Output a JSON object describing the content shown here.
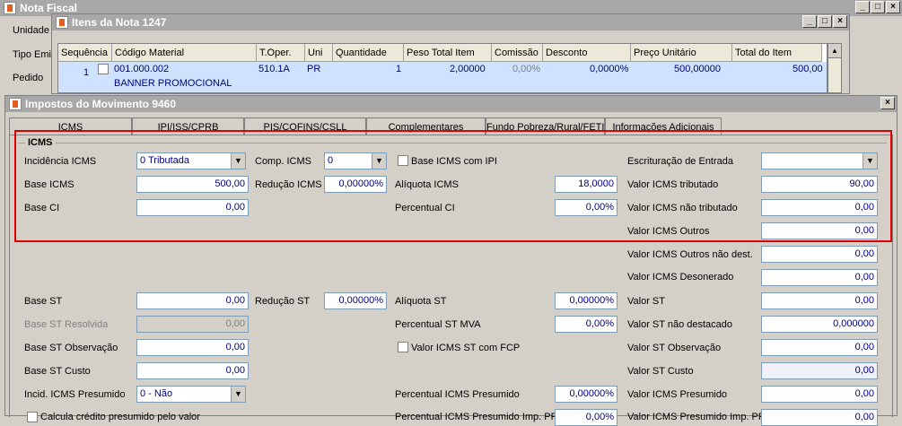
{
  "nota": {
    "title": "Nota Fiscal",
    "labels": [
      "Unidade",
      "Tipo Emis",
      "Pedido"
    ]
  },
  "itens": {
    "title": "Itens da Nota 1247",
    "columns": [
      "Sequência",
      "Código Material",
      "T.Oper.",
      "Uni",
      "Quantidade",
      "Peso Total Item",
      "Comissão",
      "Desconto",
      "Preço Unitário",
      "Total do Item"
    ],
    "row": {
      "seq": "1",
      "codigo": "001.000.002",
      "descricao": "BANNER PROMOCIONAL",
      "toper": "510.1A",
      "uni": "PR",
      "quantidade": "1",
      "peso": "2,00000",
      "comissao": "0,00%",
      "desconto": "0,0000%",
      "preco": "500,00000",
      "total": "500,00"
    }
  },
  "impostos": {
    "title": "Impostos do Movimento 9460",
    "tabs": [
      "ICMS",
      "IPI/ISS/CPRB",
      "PIS/COFINS/CSLL",
      "Complementares",
      "Fundo Pobreza/Rural/FETI",
      "Informações Adicionais"
    ],
    "group_title": "ICMS",
    "fields": {
      "incidencia_label": "Incidência ICMS",
      "incidencia_value": "0 Tributada",
      "comp_label": "Comp. ICMS",
      "comp_value": "0",
      "base_com_ipi_label": "Base ICMS com IPI",
      "escrituracao_label": "Escrituração de Entrada",
      "escrituracao_value": "",
      "base_icms_label": "Base ICMS",
      "base_icms_value": "500,00",
      "reducao_icms_label": "Redução ICMS",
      "reducao_icms_value": "0,00000%",
      "aliquota_icms_label": "Alíquota ICMS",
      "aliquota_icms_value": "18,0000",
      "valor_icms_trib_label": "Valor ICMS tributado",
      "valor_icms_trib_value": "90,00",
      "base_ci_label": "Base CI",
      "base_ci_value": "0,00",
      "percentual_ci_label": "Percentual CI",
      "percentual_ci_value": "0,00%",
      "valor_icms_ntrib_label": "Valor ICMS não tributado",
      "valor_icms_ntrib_value": "0,00",
      "valor_icms_outros_label": "Valor ICMS Outros",
      "valor_icms_outros_value": "0,00",
      "valor_icms_outros_nd_label": "Valor ICMS Outros não dest.",
      "valor_icms_outros_nd_value": "0,00",
      "valor_icms_deson_label": "Valor ICMS Desonerado",
      "valor_icms_deson_value": "0,00",
      "base_st_label": "Base ST",
      "base_st_value": "0,00",
      "reducao_st_label": "Redução ST",
      "reducao_st_value": "0,00000%",
      "aliquota_st_label": "Alíquota ST",
      "aliquota_st_value": "0,00000%",
      "valor_st_label": "Valor ST",
      "valor_st_value": "0,00",
      "base_st_resolvida_label": "Base ST Resolvida",
      "base_st_resolvida_value": "0,00",
      "percentual_st_mva_label": "Percentual ST MVA",
      "percentual_st_mva_value": "0,00%",
      "valor_st_nd_label": "Valor ST não destacado",
      "valor_st_nd_value": "0,000000",
      "base_st_obs_label": "Base ST Observação",
      "base_st_obs_value": "0,00",
      "valor_icms_st_fcp_label": "Valor ICMS ST com FCP",
      "valor_st_obs_label": "Valor ST Observação",
      "valor_st_obs_value": "0,00",
      "base_st_custo_label": "Base ST Custo",
      "base_st_custo_value": "0,00",
      "valor_st_custo_label": "Valor ST Custo",
      "valor_st_custo_value": "0,00",
      "incid_presumido_label": "Incid. ICMS Presumido",
      "incid_presumido_value": "0 - Não",
      "percentual_presumido_label": "Percentual ICMS Presumido",
      "percentual_presumido_value": "0,00000%",
      "valor_presumido_label": "Valor ICMS Presumido",
      "valor_presumido_value": "0,00",
      "calcula_credito_label": "Calcula crédito presumido pelo valor",
      "percentual_presumido_imp_label": "Percentual ICMS Presumido Imp. PR",
      "percentual_presumido_imp_value": "0,00%",
      "valor_presumido_imp_label": "Valor ICMS Presumido Imp. PR",
      "valor_presumido_imp_value": "0,00"
    }
  },
  "colors": {
    "title_bar": "#a8a8a8",
    "highlight_row": "#cfe3ff",
    "red_box": "#e00000"
  }
}
